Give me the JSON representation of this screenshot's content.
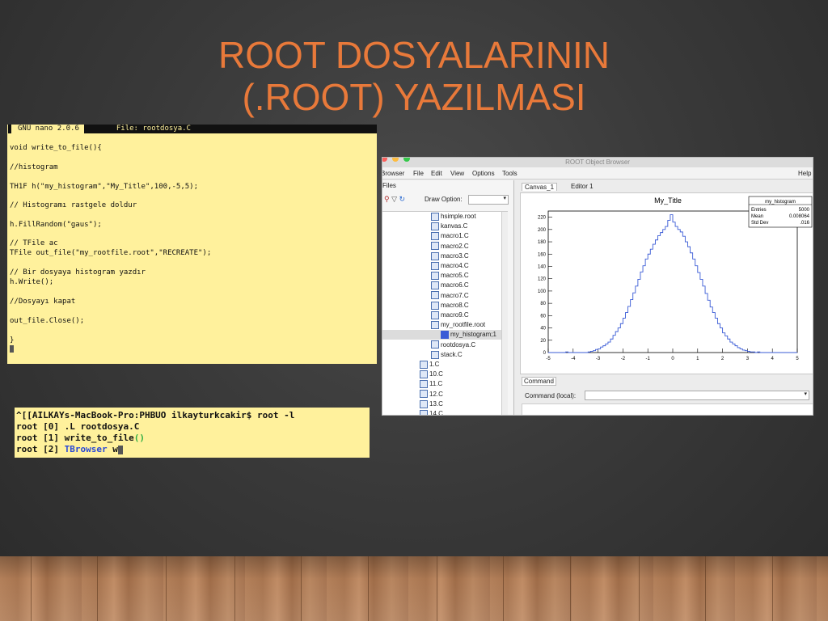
{
  "slide": {
    "title_line1": "ROOT DOSYALARININ",
    "title_line2": "(.ROOT) YAZILMASI"
  },
  "nano": {
    "header_left": "GNU nano 2.0.6",
    "header_right": "File: rootdosya.C",
    "lines": [
      "void write_to_file(){",
      "//histogram",
      "TH1F h(\"my_histogram\",\"My_Title\",100,-5,5);",
      "// Histogramı rastgele doldur",
      "h.FillRandom(\"gaus\");",
      "// TFile ac",
      "TFile out_file(\"my_rootfile.root\",\"RECREATE\");",
      "// Bir dosyaya histogram yazdır",
      "h.Write();",
      "//Dosyayı kapat",
      "out_file.Close();",
      "}"
    ]
  },
  "shell": {
    "line1": "^[[AILKAYs-MacBook-Pro:PHBUO ilkayturkcakir$ root -l",
    "line2": "root [0] .L rootdosya.C",
    "line3_prefix": "root [1] write_to_file",
    "line3_paren": "()",
    "line4_prefix": "root [2] ",
    "line4_cmd": "TBrowser",
    "line4_rest": " w"
  },
  "browser": {
    "window_title": "ROOT Object Browser",
    "menu": [
      "Browser",
      "File",
      "Edit",
      "View",
      "Options",
      "Tools",
      "Help"
    ],
    "left_tab": "Files",
    "draw_option_label": "Draw Option:",
    "tabs": [
      "Canvas_1",
      "Editor 1"
    ],
    "tree": [
      "hsimple.root",
      "kanvas.C",
      "macro1.C",
      "macro2.C",
      "macro3.C",
      "macro4.C",
      "macro5.C",
      "macro6.C",
      "macro7.C",
      "macro8.C",
      "macro9.C",
      "my_rootfile.root",
      "my_histogram;1",
      "rootdosya.C",
      "stack.C",
      "1.C",
      "10.C",
      "11.C",
      "12.C",
      "13.C",
      "14.C"
    ],
    "command_tab": "Command",
    "command_label": "Command (local):"
  },
  "chart_data": {
    "type": "step",
    "title": "My_Title",
    "xlim": [
      -5,
      5
    ],
    "ylim": [
      0,
      230
    ],
    "xticks": [
      -5,
      -4,
      -3,
      -2,
      -1,
      0,
      1,
      2,
      3,
      4,
      5
    ],
    "yticks": [
      0,
      20,
      40,
      60,
      80,
      100,
      120,
      140,
      160,
      180,
      200,
      220
    ],
    "bins": 100,
    "stats": {
      "name": "my_histogram",
      "rows": [
        {
          "label": "Entries",
          "value": "5000"
        },
        {
          "label": "Mean",
          "value": "0.008064"
        },
        {
          "label": "Std Dev",
          "value": ".016"
        }
      ]
    },
    "series": [
      {
        "color": "#3a5bd6",
        "y": [
          0,
          0,
          0,
          0,
          0,
          0,
          0,
          1,
          0,
          0,
          0,
          0,
          0,
          0,
          0,
          0,
          1,
          2,
          3,
          5,
          6,
          9,
          11,
          14,
          17,
          22,
          28,
          34,
          40,
          47,
          56,
          65,
          75,
          86,
          97,
          108,
          119,
          131,
          141,
          152,
          160,
          168,
          176,
          183,
          190,
          195,
          200,
          205,
          215,
          224,
          212,
          205,
          200,
          196,
          189,
          180,
          172,
          162,
          152,
          141,
          130,
          119,
          108,
          96,
          85,
          74,
          65,
          56,
          47,
          40,
          32,
          27,
          22,
          17,
          14,
          11,
          8,
          6,
          4,
          3,
          2,
          1,
          1,
          0,
          1,
          0,
          0,
          0,
          0,
          0,
          0,
          0,
          0,
          0,
          0,
          0,
          0,
          0,
          0,
          0
        ]
      }
    ]
  }
}
